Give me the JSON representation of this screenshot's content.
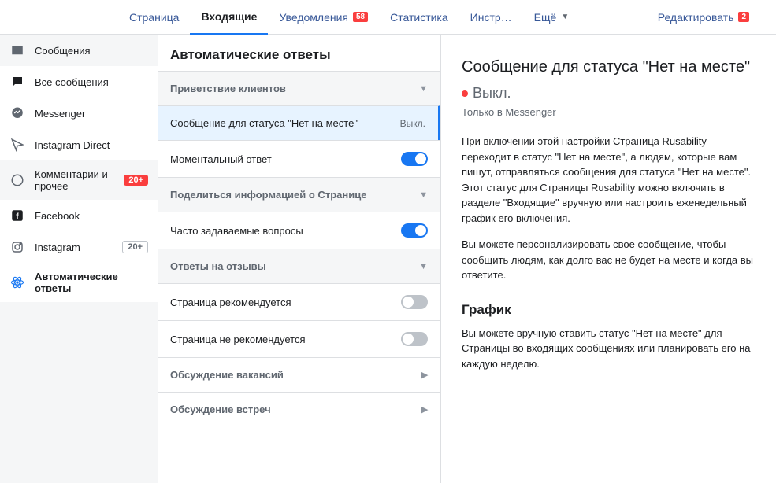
{
  "topnav": {
    "items": [
      "Страница",
      "Входящие",
      "Уведомления",
      "Статистика",
      "Инстр…",
      "Ещё"
    ],
    "badge_notifications": "58",
    "edit_label": "Редактировать",
    "edit_badge": "2"
  },
  "sidebar": {
    "items": [
      {
        "icon": "inbox",
        "label": "Сообщения"
      },
      {
        "icon": "comment",
        "label": "Все сообщения"
      },
      {
        "icon": "messenger",
        "label": "Messenger"
      },
      {
        "icon": "instagram-direct",
        "label": "Instagram Direct"
      },
      {
        "icon": "comments",
        "label": "Комментарии и прочее",
        "badge": "20+",
        "badge_red": true
      },
      {
        "icon": "facebook",
        "label": "Facebook"
      },
      {
        "icon": "instagram",
        "label": "Instagram",
        "badge": "20+",
        "badge_red": false
      },
      {
        "icon": "atom",
        "label": "Автоматические ответы",
        "active": true
      }
    ]
  },
  "midcol": {
    "title": "Автоматические ответы",
    "sections": [
      {
        "header": "Приветствие клиентов",
        "expanded": true,
        "items": [
          {
            "label": "Сообщение для статуса \"Нет на месте\"",
            "state_text": "Выкл.",
            "selected": true
          },
          {
            "label": "Моментальный ответ",
            "toggle": "on"
          }
        ]
      },
      {
        "header": "Поделиться информацией о Странице",
        "expanded": true,
        "items": [
          {
            "label": "Часто задаваемые вопросы",
            "toggle": "on"
          }
        ]
      },
      {
        "header": "Ответы на отзывы",
        "expanded": true,
        "items": [
          {
            "label": "Страница рекомендуется",
            "toggle": "off"
          },
          {
            "label": "Страница не рекомендуется",
            "toggle": "off"
          }
        ]
      },
      {
        "header": "Обсуждение вакансий",
        "expanded": false
      },
      {
        "header": "Обсуждение встреч",
        "expanded": false
      }
    ]
  },
  "detail": {
    "title": "Сообщение для статуса \"Нет на месте\"",
    "status": "Выкл.",
    "channel": "Только в Messenger",
    "para1": "При включении этой настройки Страница Rusability переходит в статус \"Нет на месте\", а людям, которые вам пишут, отправляться сообщения для статуса \"Нет на месте\". Этот статус для Страницы Rusability можно включить в разделе \"Входящие\" вручную или настроить еженедельный график его включения.",
    "para2": "Вы можете персонализировать свое сообщение, чтобы сообщить людям, как долго вас не будет на месте и когда вы ответите.",
    "schedule_header": "График",
    "para3": "Вы можете вручную ставить статус \"Нет на месте\" для Страницы во входящих сообщениях или планировать его на каждую неделю."
  }
}
